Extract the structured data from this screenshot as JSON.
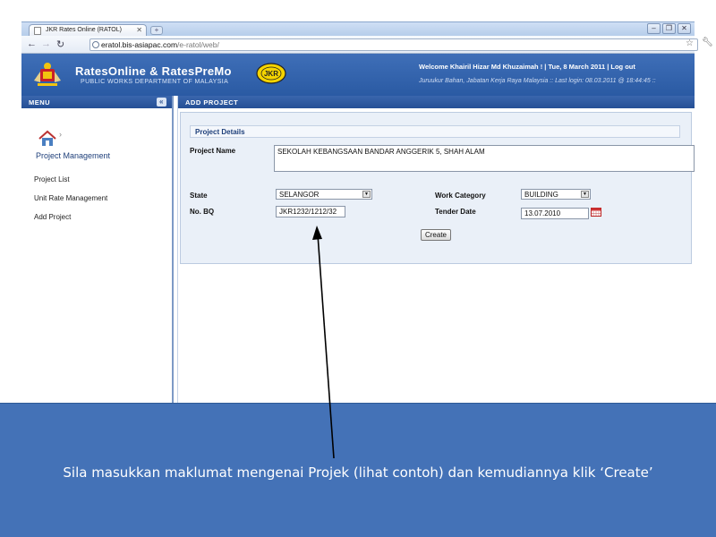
{
  "browser": {
    "tab_title": "JKR Rates Online (RATOL)",
    "url_host": "eratol.bis-asiapac.com",
    "url_path": "/e-ratol/web/"
  },
  "header": {
    "brand": "RatesOnline & RatesPreMo",
    "subtitle": "PUBLIC WORKS DEPARTMENT OF MALAYSIA",
    "jkr_logo_text": "JKR",
    "welcome": "Welcome Khairil Hizar Md Khuzaimah ! | Tue, 8 March 2011 | Log out",
    "last_login": "Juruukur Bahan, Jabatan Kerja Raya Malaysia :: Last login: 08.03.2011 @ 18:44:45 ::"
  },
  "menu": {
    "title": "MENU",
    "collapse_glyph": "«",
    "section_title": "Project Management",
    "items": [
      {
        "label": "Project List"
      },
      {
        "label": "Unit Rate Management"
      },
      {
        "label": "Add Project"
      }
    ]
  },
  "main": {
    "title": "ADD PROJECT",
    "panel_title": "Project Details",
    "project_name_label": "Project Name",
    "project_name_value": "SEKOLAH KEBANGSAAN BANDAR ANGGERIK 5, SHAH ALAM",
    "state_label": "State",
    "state_value": "SELANGOR",
    "no_bq_label": "No. BQ",
    "no_bq_value": "JKR1232/1212/32",
    "work_category_label": "Work Category",
    "work_category_value": "BUILDING",
    "tender_date_label": "Tender Date",
    "tender_date_value": "13.07.2010",
    "create_label": "Create"
  },
  "caption": {
    "text": "Sila masukkan maklumat mengenai Projek (lihat contoh) dan kemudiannya klik ‘Create’"
  },
  "colors": {
    "header_blue": "#2a5aa3",
    "caption_blue": "#4472b7",
    "panel_bg": "#eaf0f8"
  }
}
